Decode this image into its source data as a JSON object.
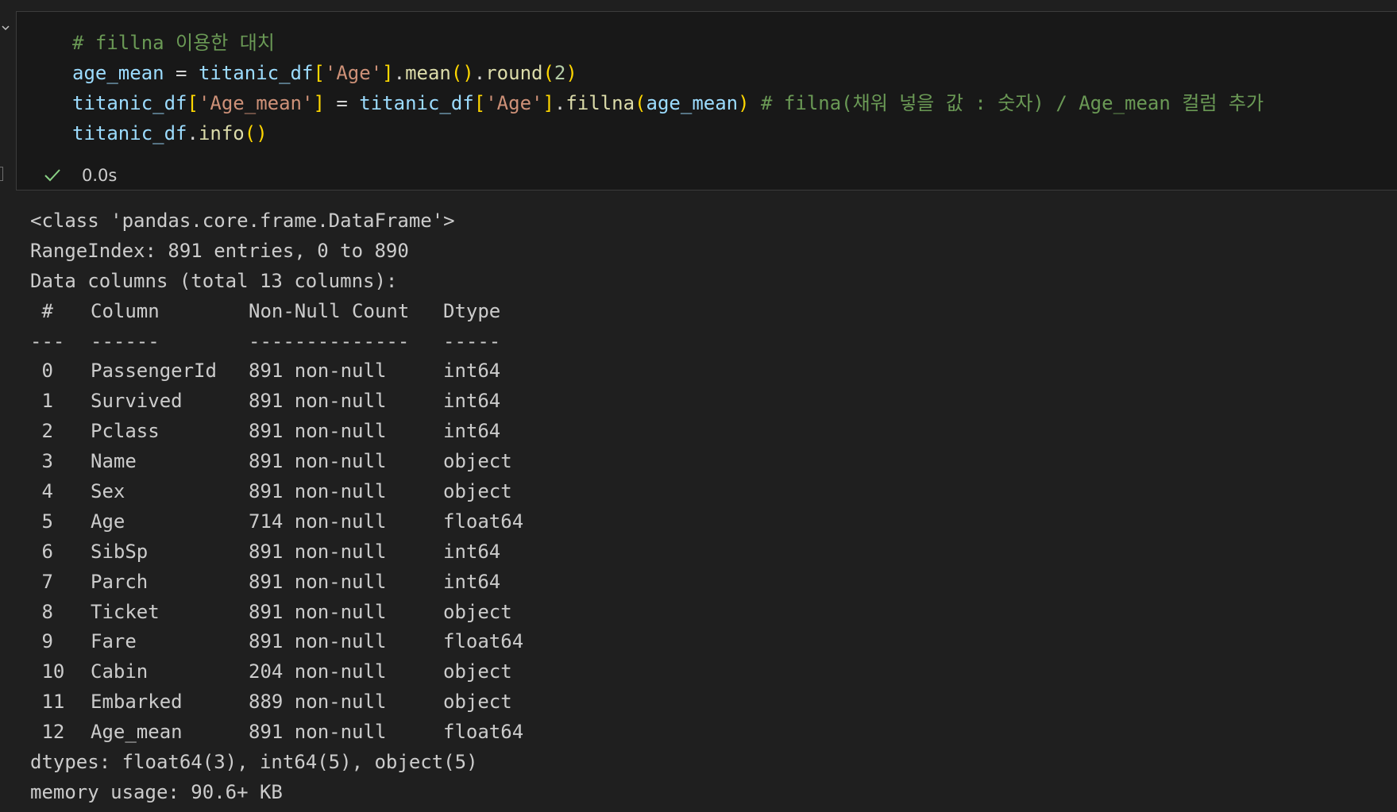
{
  "code_cell": {
    "lines": [
      {
        "tokens": [
          {
            "t": "# fillna 이용한 대치",
            "c": "tok-comment"
          }
        ]
      },
      {
        "tokens": [
          {
            "t": "age_mean",
            "c": "tok-var"
          },
          {
            "t": " = ",
            "c": "tok-op"
          },
          {
            "t": "titanic_df",
            "c": "tok-var"
          },
          {
            "t": "[",
            "c": "tok-bracket"
          },
          {
            "t": "'Age'",
            "c": "tok-str"
          },
          {
            "t": "]",
            "c": "tok-bracket"
          },
          {
            "t": ".",
            "c": "tok-op"
          },
          {
            "t": "mean",
            "c": "tok-fn"
          },
          {
            "t": "()",
            "c": "tok-bracket"
          },
          {
            "t": ".",
            "c": "tok-op"
          },
          {
            "t": "round",
            "c": "tok-fn"
          },
          {
            "t": "(",
            "c": "tok-bracket"
          },
          {
            "t": "2",
            "c": "tok-num"
          },
          {
            "t": ")",
            "c": "tok-bracket"
          }
        ]
      },
      {
        "tokens": [
          {
            "t": "titanic_df",
            "c": "tok-var"
          },
          {
            "t": "[",
            "c": "tok-bracket"
          },
          {
            "t": "'Age_mean'",
            "c": "tok-str"
          },
          {
            "t": "]",
            "c": "tok-bracket"
          },
          {
            "t": " = ",
            "c": "tok-op"
          },
          {
            "t": "titanic_df",
            "c": "tok-var"
          },
          {
            "t": "[",
            "c": "tok-bracket"
          },
          {
            "t": "'Age'",
            "c": "tok-str"
          },
          {
            "t": "]",
            "c": "tok-bracket"
          },
          {
            "t": ".",
            "c": "tok-op"
          },
          {
            "t": "fillna",
            "c": "tok-fn"
          },
          {
            "t": "(",
            "c": "tok-bracket"
          },
          {
            "t": "age_mean",
            "c": "tok-var"
          },
          {
            "t": ")",
            "c": "tok-bracket"
          },
          {
            "t": " # filna(채워 넣을 값 : 숫자) / Age_mean 컬럼 추가",
            "c": "tok-comment"
          }
        ]
      },
      {
        "tokens": [
          {
            "t": "titanic_df",
            "c": "tok-var"
          },
          {
            "t": ".",
            "c": "tok-op"
          },
          {
            "t": "info",
            "c": "tok-fn"
          },
          {
            "t": "()",
            "c": "tok-bracket"
          }
        ]
      }
    ]
  },
  "status": {
    "exec_time": "0.0s"
  },
  "output": {
    "header_lines": [
      "<class 'pandas.core.frame.DataFrame'>",
      "RangeIndex: 891 entries, 0 to 890",
      "Data columns (total 13 columns):"
    ],
    "table_header": {
      "idx": " #",
      "name": "Column",
      "count": "Non-Null Count",
      "type": "Dtype"
    },
    "table_sep": {
      "idx": "---",
      "name": "------",
      "count": "--------------",
      "type": "-----"
    },
    "rows": [
      {
        "idx": " 0",
        "name": "PassengerId",
        "count": "891 non-null",
        "type": "int64"
      },
      {
        "idx": " 1",
        "name": "Survived",
        "count": "891 non-null",
        "type": "int64"
      },
      {
        "idx": " 2",
        "name": "Pclass",
        "count": "891 non-null",
        "type": "int64"
      },
      {
        "idx": " 3",
        "name": "Name",
        "count": "891 non-null",
        "type": "object"
      },
      {
        "idx": " 4",
        "name": "Sex",
        "count": "891 non-null",
        "type": "object"
      },
      {
        "idx": " 5",
        "name": "Age",
        "count": "714 non-null",
        "type": "float64"
      },
      {
        "idx": " 6",
        "name": "SibSp",
        "count": "891 non-null",
        "type": "int64"
      },
      {
        "idx": " 7",
        "name": "Parch",
        "count": "891 non-null",
        "type": "int64"
      },
      {
        "idx": " 8",
        "name": "Ticket",
        "count": "891 non-null",
        "type": "object"
      },
      {
        "idx": " 9",
        "name": "Fare",
        "count": "891 non-null",
        "type": "float64"
      },
      {
        "idx": " 10",
        "name": "Cabin",
        "count": "204 non-null",
        "type": "object"
      },
      {
        "idx": " 11",
        "name": "Embarked",
        "count": "889 non-null",
        "type": "object"
      },
      {
        "idx": " 12",
        "name": "Age_mean",
        "count": "891 non-null",
        "type": "float64"
      }
    ],
    "footer_lines": [
      "dtypes: float64(3), int64(5), object(5)",
      "memory usage: 90.6+ KB"
    ]
  },
  "icons": {
    "collapse": "chevron-down-icon",
    "status": "check-icon"
  },
  "colors": {
    "success": "#89d185",
    "background": "#1f1f1f",
    "cell_background": "#181818"
  }
}
